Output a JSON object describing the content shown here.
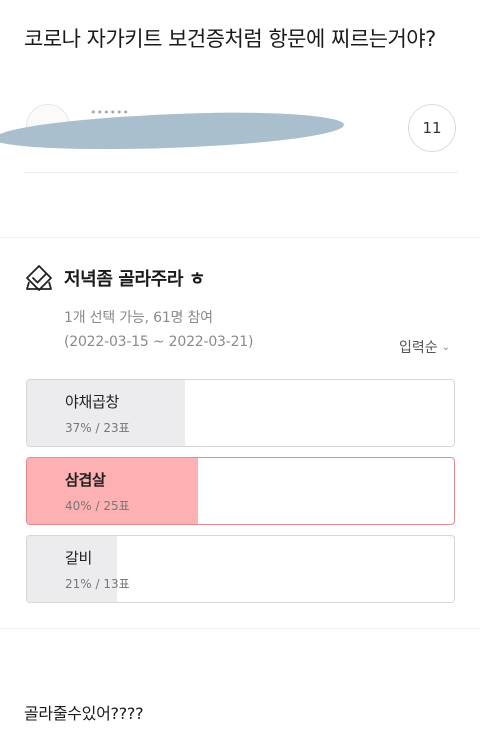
{
  "post": {
    "title": "코로나 자가키트 보건증처럼 항문에 찌르는거야?",
    "author_name": "••••••",
    "comment_count": "11"
  },
  "poll": {
    "title": "저녁좀 골라주라 ㅎ",
    "meta": "1개 선택 가능, 61명 참여",
    "dates": "(2022-03-15 ~ 2022-03-21)",
    "sort_label": "입력순",
    "options": [
      {
        "label": "야채곱창",
        "stat": "37% / 23표",
        "percent": 37,
        "selected": false
      },
      {
        "label": "삼겹살",
        "stat": "40% / 25표",
        "percent": 40,
        "selected": true
      },
      {
        "label": "갈비",
        "stat": "21% / 13표",
        "percent": 21,
        "selected": false
      }
    ]
  },
  "comment": {
    "text": "골라줄수있어????"
  },
  "colors": {
    "selected_fill": "#fdb1b3",
    "default_fill": "#ececee",
    "redaction": "#a9bfcd"
  },
  "icons": {
    "poll": "poll-check-icon",
    "sort": "chevron-down-icon"
  }
}
